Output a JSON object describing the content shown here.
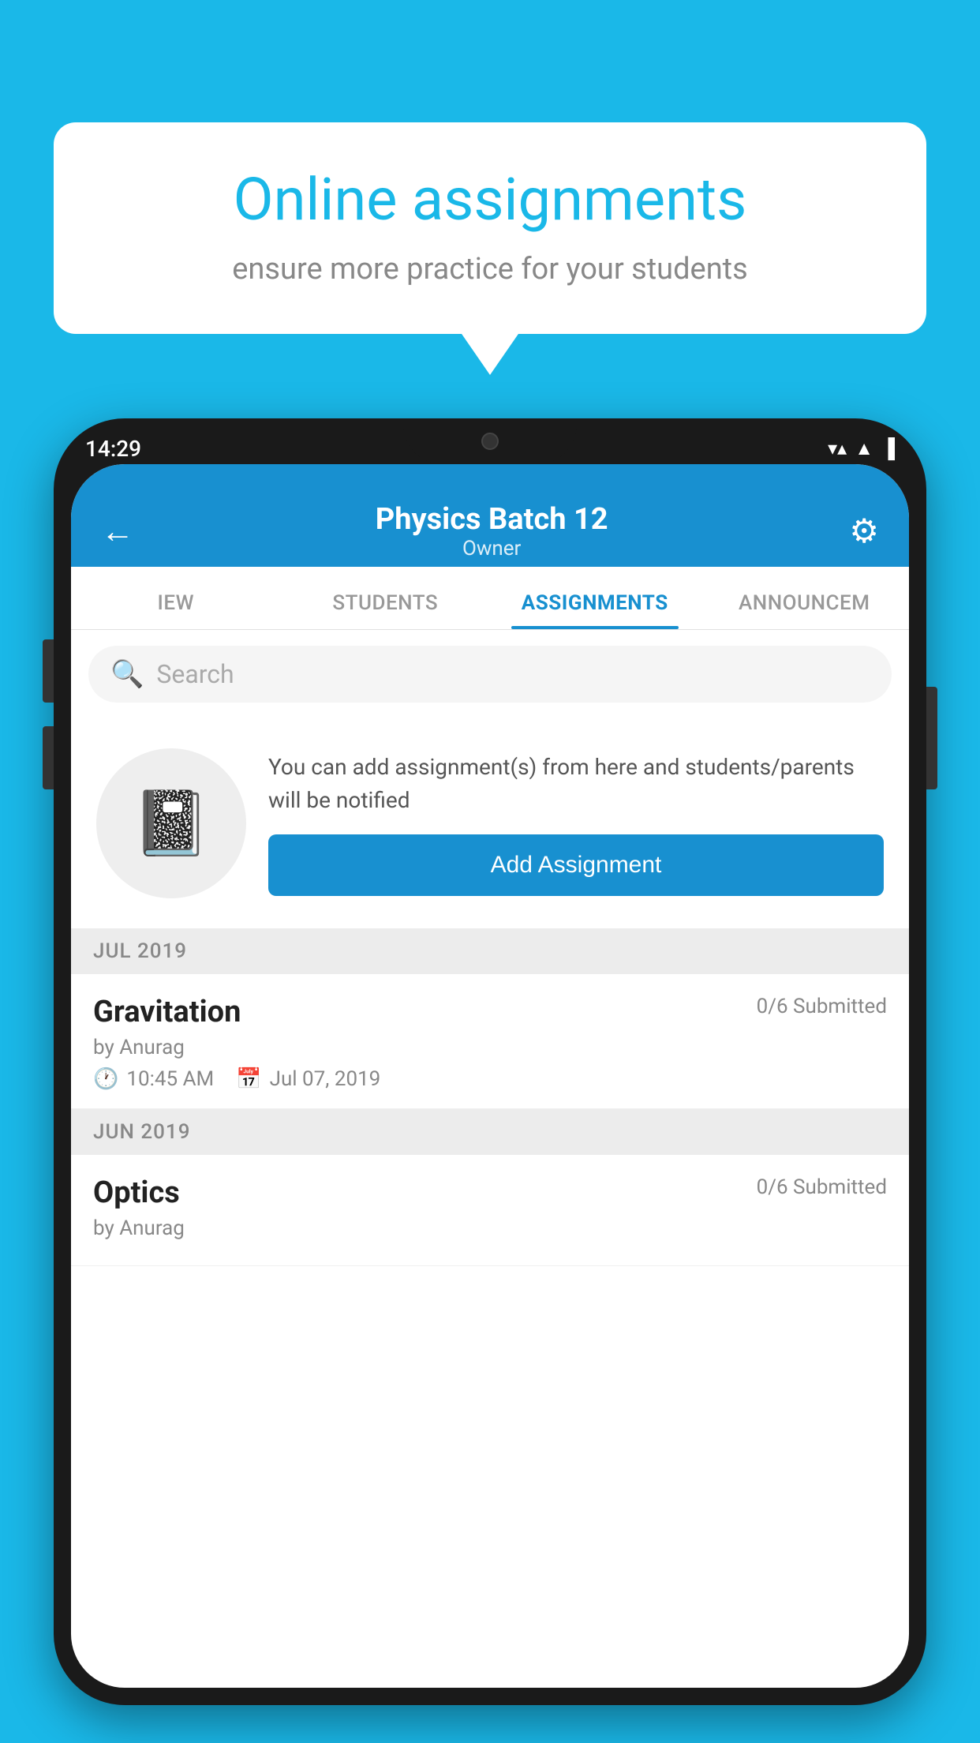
{
  "background_color": "#1ab8e8",
  "speech_bubble": {
    "title": "Online assignments",
    "subtitle": "ensure more practice for your students"
  },
  "phone": {
    "status_bar": {
      "time": "14:29",
      "wifi": "▼▲",
      "signal": "▲",
      "battery": "▐"
    },
    "header": {
      "title": "Physics Batch 12",
      "subtitle": "Owner",
      "back_label": "←",
      "settings_label": "⚙"
    },
    "tabs": [
      {
        "label": "IEW",
        "active": false
      },
      {
        "label": "STUDENTS",
        "active": false
      },
      {
        "label": "ASSIGNMENTS",
        "active": true
      },
      {
        "label": "ANNOUNCЕМ",
        "active": false
      }
    ],
    "search": {
      "placeholder": "Search"
    },
    "empty_state": {
      "text": "You can add assignment(s) from here and students/parents will be notified",
      "button_label": "Add Assignment"
    },
    "sections": [
      {
        "label": "JUL 2019",
        "assignments": [
          {
            "name": "Gravitation",
            "submitted": "0/6 Submitted",
            "by": "by Anurag",
            "time": "10:45 AM",
            "date": "Jul 07, 2019"
          }
        ]
      },
      {
        "label": "JUN 2019",
        "assignments": [
          {
            "name": "Optics",
            "submitted": "0/6 Submitted",
            "by": "by Anurag",
            "time": "",
            "date": ""
          }
        ]
      }
    ]
  }
}
